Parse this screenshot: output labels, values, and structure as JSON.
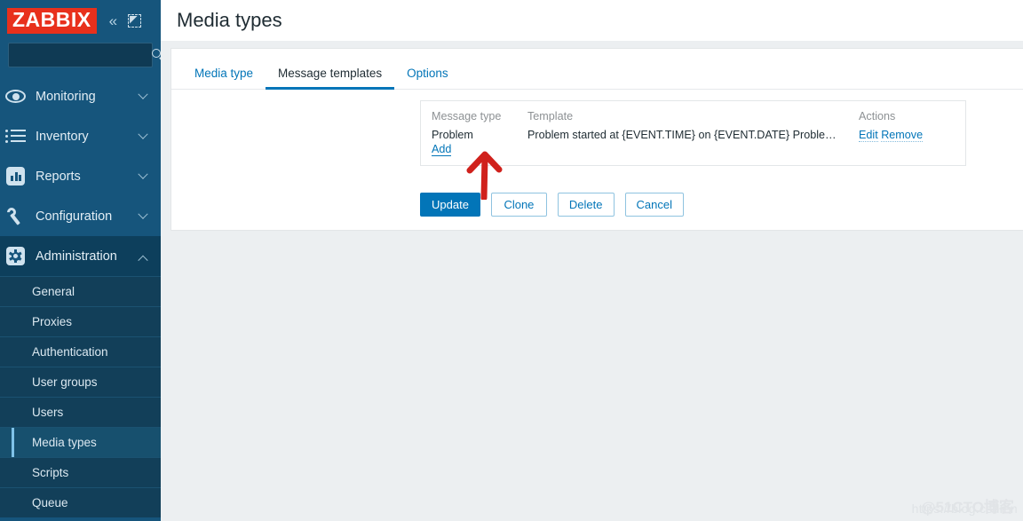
{
  "sidebar": {
    "logo_text": "ZABBIX",
    "collapse_label": "«",
    "search": {
      "placeholder": "",
      "value": ""
    },
    "nav": [
      {
        "label": "Monitoring",
        "icon": "eye-icon",
        "expanded": false
      },
      {
        "label": "Inventory",
        "icon": "list-icon",
        "expanded": false
      },
      {
        "label": "Reports",
        "icon": "reports-icon",
        "expanded": false
      },
      {
        "label": "Configuration",
        "icon": "wrench-icon",
        "expanded": false
      },
      {
        "label": "Administration",
        "icon": "gear-icon",
        "expanded": true
      }
    ],
    "submenu": [
      {
        "label": "General",
        "selected": false
      },
      {
        "label": "Proxies",
        "selected": false
      },
      {
        "label": "Authentication",
        "selected": false
      },
      {
        "label": "User groups",
        "selected": false
      },
      {
        "label": "Users",
        "selected": false
      },
      {
        "label": "Media types",
        "selected": true
      },
      {
        "label": "Scripts",
        "selected": false
      },
      {
        "label": "Queue",
        "selected": false
      }
    ]
  },
  "header": {
    "title": "Media types"
  },
  "tabs": [
    {
      "label": "Media type",
      "active": false
    },
    {
      "label": "Message templates",
      "active": true
    },
    {
      "label": "Options",
      "active": false
    }
  ],
  "message_templates": {
    "columns": [
      "Message type",
      "Template",
      "Actions"
    ],
    "rows": [
      {
        "message_type": "Problem",
        "template": "Problem started at {EVENT.TIME} on {EVENT.DATE} Proble…",
        "actions": [
          "Edit",
          "Remove"
        ]
      }
    ],
    "add_label": "Add"
  },
  "buttons": [
    {
      "label": "Update",
      "style": "primary"
    },
    {
      "label": "Clone",
      "style": "secondary"
    },
    {
      "label": "Delete",
      "style": "secondary"
    },
    {
      "label": "Cancel",
      "style": "secondary"
    }
  ],
  "annotation": {
    "type": "red-up-arrow",
    "color": "#d0211c"
  },
  "watermark": {
    "line1": "https://blog.csdn.n",
    "line2": "@51CTO博客"
  },
  "colors": {
    "sidebar_bg": "#16557c",
    "sidebar_active_bg": "#0d3f5c",
    "logo_bg": "#e8301c",
    "accent_blue": "#0275b8",
    "page_bg": "#eceff1"
  }
}
